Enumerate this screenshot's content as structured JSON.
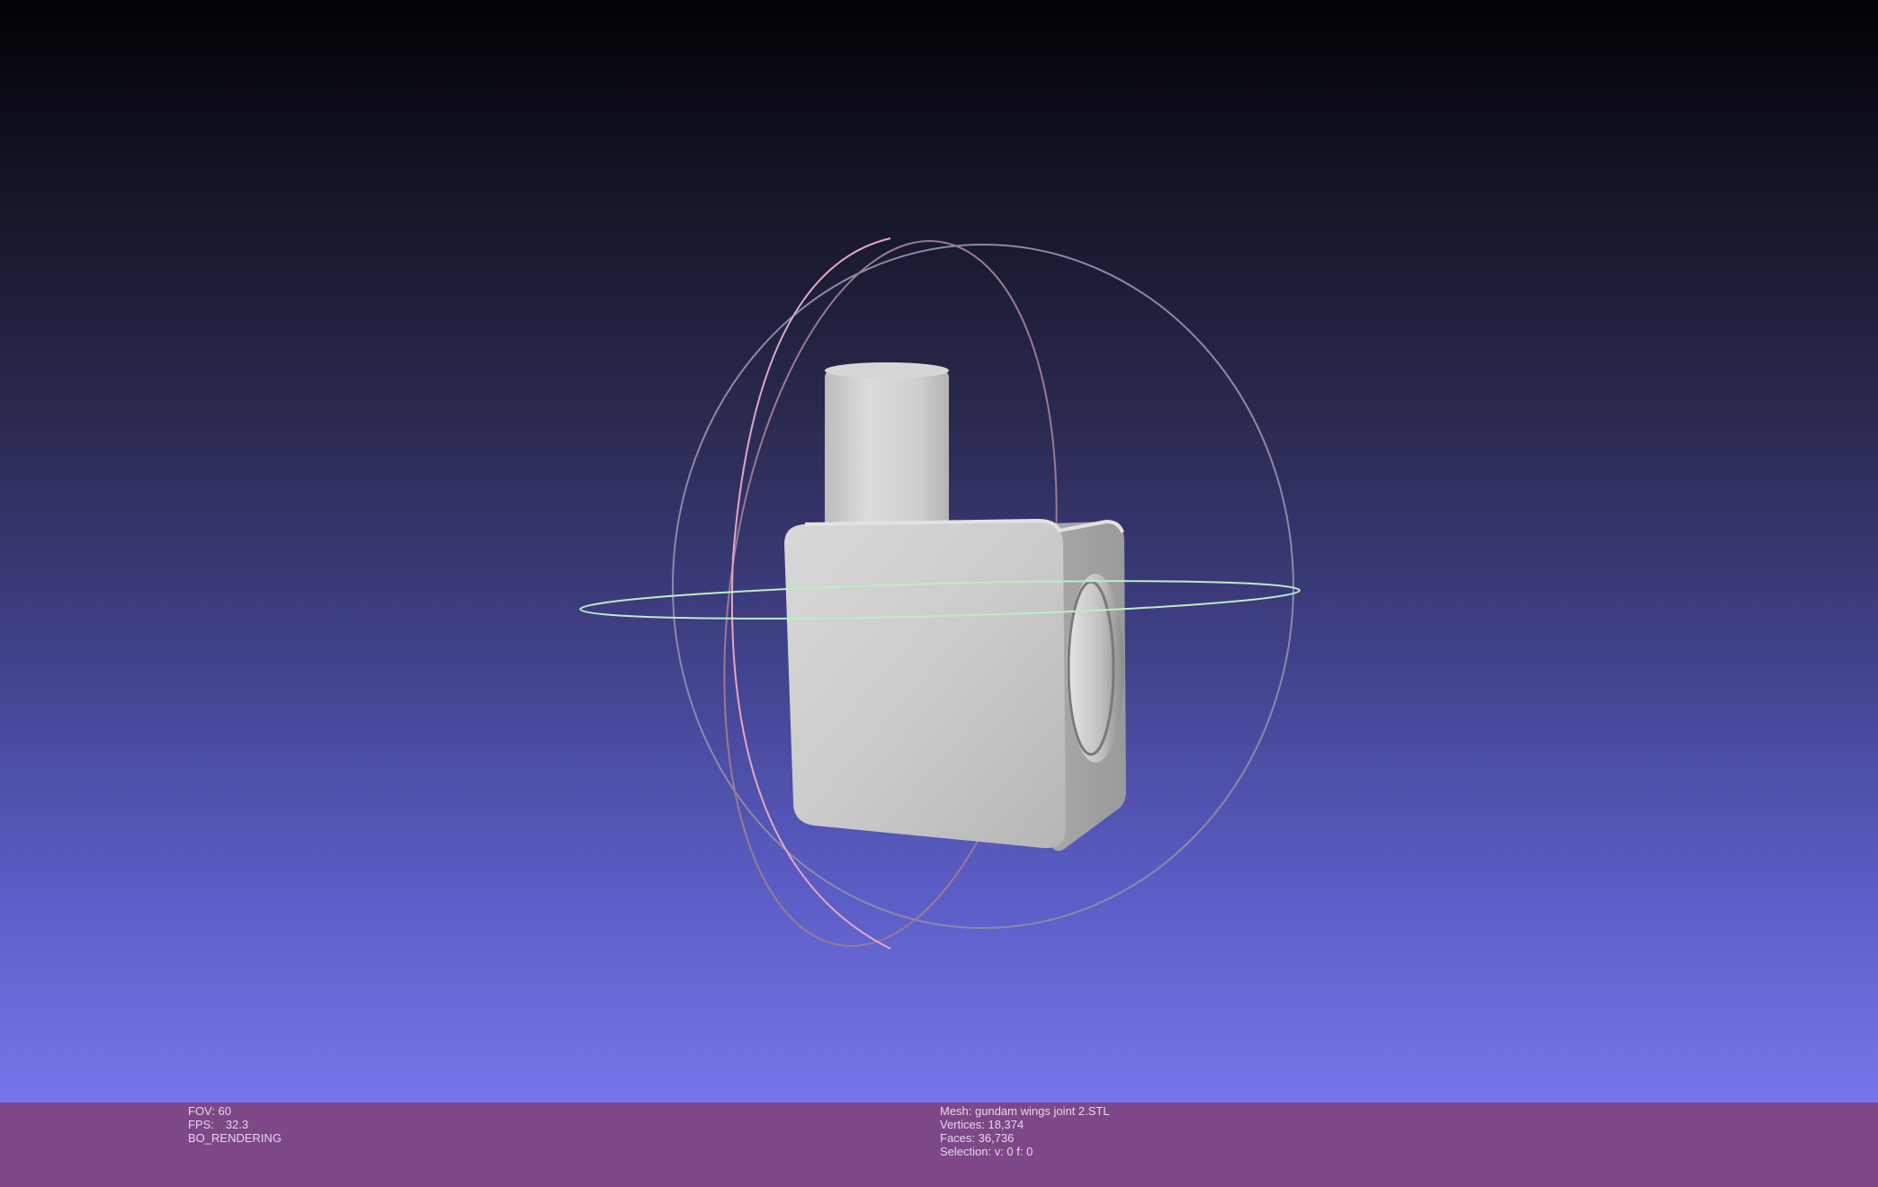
{
  "viewer": {
    "background_top": "#020205",
    "background_bottom": "#7576ea",
    "info_bar_color": "#7e4787",
    "mesh_color": "#c8c8c8",
    "trackball_x_ring_color": "#e0a0b8",
    "trackball_y_ring_color": "#b0b0d8",
    "trackball_z_ring_color": "#b8f0c0"
  },
  "status_left": {
    "fov": "FOV: 60",
    "fps_label": "FPS:",
    "fps_value": "32.3",
    "render_mode": "BO_RENDERING"
  },
  "status_right": {
    "mesh": "Mesh: gundam wings joint 2.STL",
    "vertices": "Vertices: 18,374",
    "faces": "Faces: 36,736",
    "selection": "Selection: v: 0 f: 0"
  },
  "scene": {
    "object_icon": "stl-mesh",
    "trackball_icon": "trackball-gizmo"
  }
}
